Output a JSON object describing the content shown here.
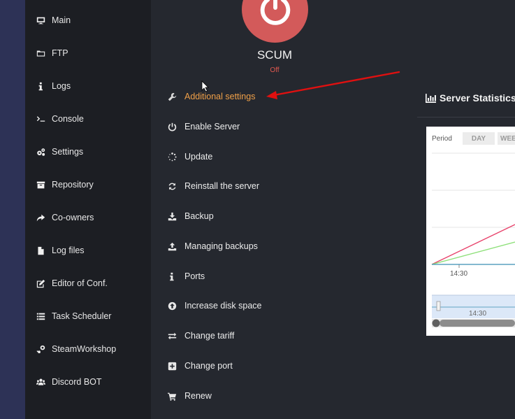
{
  "sidebar": {
    "items": [
      {
        "label": "Main",
        "icon": "monitor-icon"
      },
      {
        "label": "FTP",
        "icon": "folder-icon"
      },
      {
        "label": "Logs",
        "icon": "info-icon"
      },
      {
        "label": "Console",
        "icon": "terminal-icon"
      },
      {
        "label": "Settings",
        "icon": "cogs-icon"
      },
      {
        "label": "Repository",
        "icon": "archive-icon"
      },
      {
        "label": "Co-owners",
        "icon": "share-icon"
      },
      {
        "label": "Log files",
        "icon": "file-icon"
      },
      {
        "label": "Editor of Conf.",
        "icon": "edit-icon"
      },
      {
        "label": "Task Scheduler",
        "icon": "list-icon"
      },
      {
        "label": "SteamWorkshop",
        "icon": "steam-icon"
      },
      {
        "label": "Discord BOT",
        "icon": "users-icon"
      }
    ]
  },
  "server": {
    "name": "SCUM",
    "status": "Off"
  },
  "actions": [
    {
      "label": "Additional settings",
      "icon": "wrench-icon"
    },
    {
      "label": "Enable Server",
      "icon": "power-icon"
    },
    {
      "label": "Update",
      "icon": "spinner-icon"
    },
    {
      "label": "Reinstall the server",
      "icon": "refresh-icon"
    },
    {
      "label": "Backup",
      "icon": "download-icon"
    },
    {
      "label": "Managing backups",
      "icon": "upload-icon"
    },
    {
      "label": "Ports",
      "icon": "info-icon"
    },
    {
      "label": "Increase disk space",
      "icon": "arrow-up-circle-icon"
    },
    {
      "label": "Change tariff",
      "icon": "exchange-icon"
    },
    {
      "label": "Change port",
      "icon": "plus-square-icon"
    },
    {
      "label": "Renew",
      "icon": "cart-icon"
    }
  ],
  "stats": {
    "title": "Server Statistics",
    "period_label": "Period",
    "periods": [
      "DAY",
      "WEEK"
    ],
    "x_tick": "14:30",
    "nav_tick": "14:30"
  },
  "colors": {
    "accent": "#f0a048",
    "power": "#d35a5a",
    "status_off": "#e0584f",
    "arrow": "#e01010"
  }
}
